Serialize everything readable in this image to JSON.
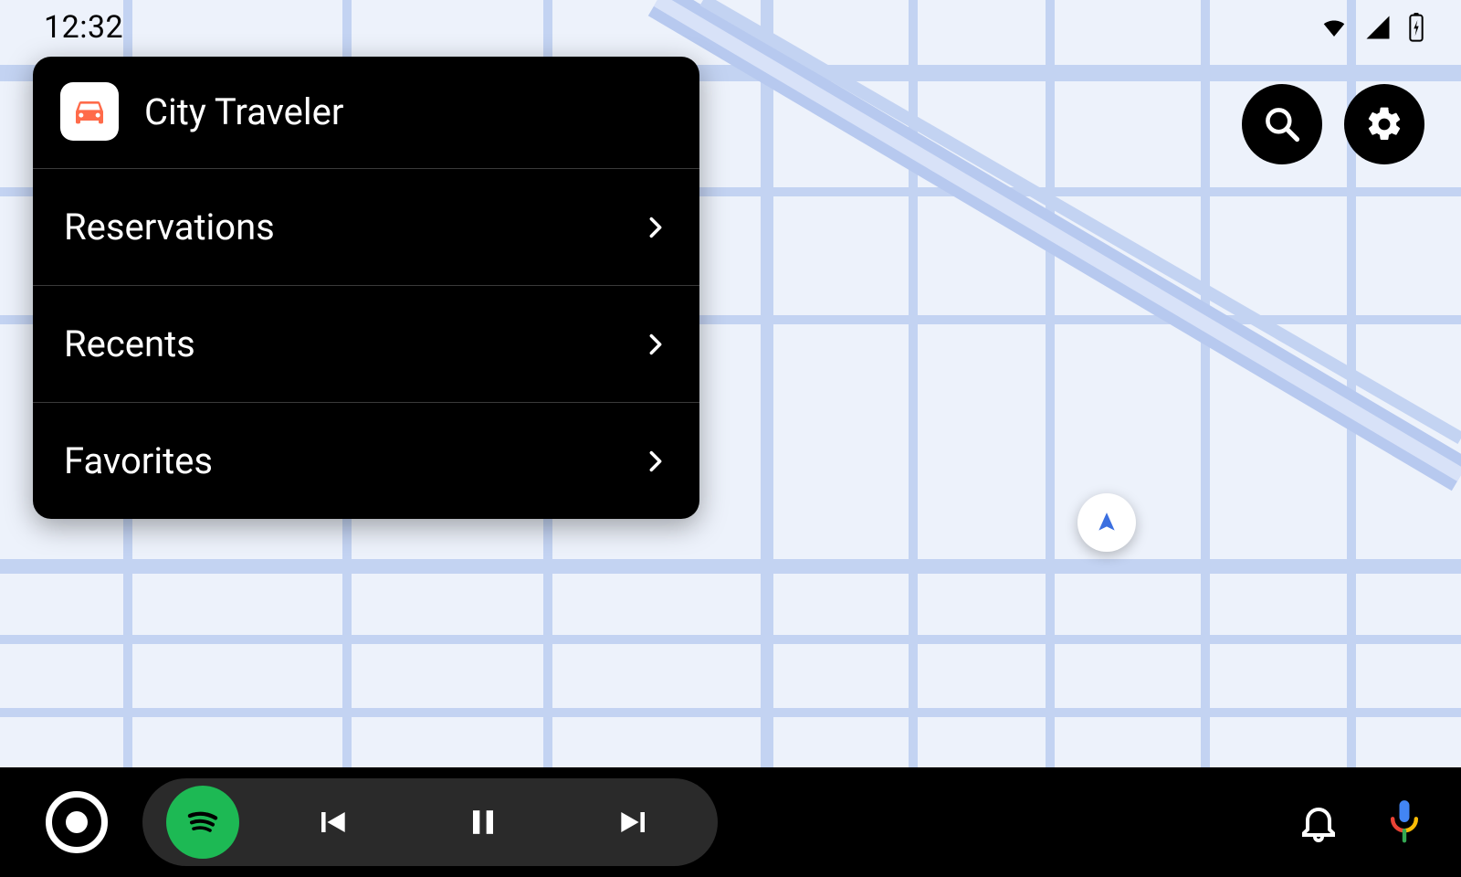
{
  "statusbar": {
    "clock": "12:32",
    "icons": {
      "wifi": "wifi-icon",
      "signal": "cell-signal-icon",
      "battery": "battery-charging-icon"
    }
  },
  "fabs": {
    "search": "search-icon",
    "settings": "gear-icon"
  },
  "panel": {
    "app_icon": "car-icon",
    "title": "City Traveler",
    "items": [
      {
        "label": "Reservations"
      },
      {
        "label": "Recents"
      },
      {
        "label": "Favorites"
      }
    ]
  },
  "location_marker": {
    "icon": "navigation-arrow-icon"
  },
  "navbar": {
    "home": "home-icon",
    "media_app_icon": "spotify-icon",
    "controls": {
      "prev": "skip-previous-icon",
      "playpause": "pause-icon",
      "next": "skip-next-icon"
    },
    "notifications": "bell-icon",
    "assistant": "mic-icon"
  },
  "colors": {
    "spotify_green": "#1DB954",
    "map_bg": "#edf2fb",
    "app_icon_tint": "#ff6b4a",
    "assistant_blue": "#4285F4",
    "assistant_red": "#EA4335",
    "assistant_yellow": "#FBBC05",
    "assistant_green": "#34A853"
  }
}
